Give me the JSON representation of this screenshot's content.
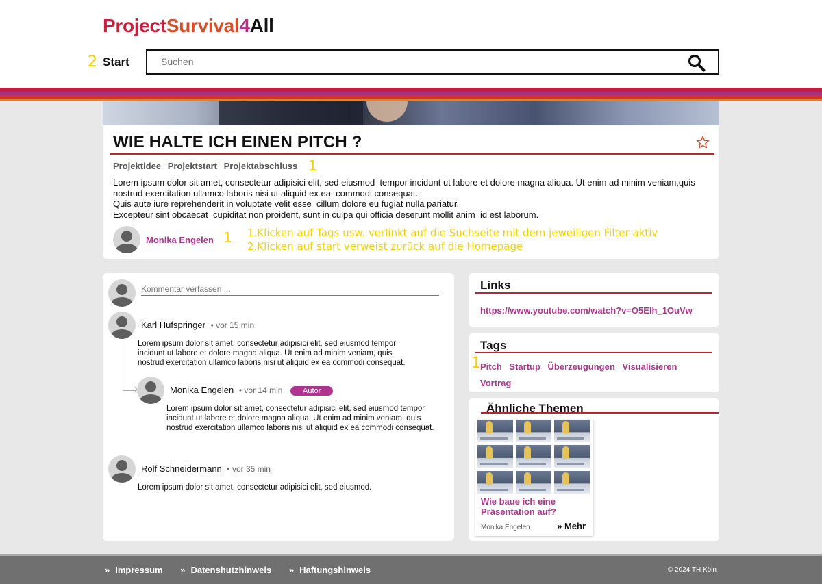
{
  "header": {
    "logo_part1": "Project",
    "logo_part2": "Survival",
    "logo_part3": "4",
    "logo_part4": "All",
    "nav_number": "2",
    "start_label": "Start",
    "search_placeholder": "Suchen"
  },
  "article": {
    "title": "WIE HALTE ICH EINEN PITCH ?",
    "phase_tags": [
      "Projektidee",
      "Projektstart",
      "Projektabschluss"
    ],
    "phase_tags_number": "1",
    "paragraphs": [
      "Lorem ipsum dolor sit amet, consectetur adipisici elit, sed eiusmod  tempor incidunt ut labore et dolore magna aliqua. Ut enim ad minim veniam,quis nostrud exercitation ullamco laboris nisi ut aliquid ex ea  commodi consequat.",
      "Quis aute iure reprehenderit in voluptate velit esse  cillum dolore eu fugiat nulla pariatur.",
      "Excepteur sint obcaecat  cupiditat non proident, sunt in culpa qui officia deserunt mollit anim  id est laborum."
    ],
    "author": "Monika Engelen",
    "author_number": "1"
  },
  "annotations": {
    "line1": "1.Klicken auf Tags usw. verlinkt auf die Suchseite mit dem jeweiligen Filter aktiv",
    "line2": "2.Klicken auf start verweist zurück auf die Homepage"
  },
  "comments": {
    "input_placeholder": "Kommentar verfassen ...",
    "items": [
      {
        "name": "Karl Hufspringer",
        "time": "• vor 15 min",
        "text": "Lorem ipsum dolor sit amet, consectetur adipisici elit, sed eiusmod  tempor incidunt ut labore et dolore magna aliqua. Ut enim ad minim  veniam, quis nostrud exercitation ullamco laboris nisi ut aliquid ex ea  commodi consequat."
      },
      {
        "name": "Monika Engelen",
        "time": "• vor 14 min",
        "badge": "Autor",
        "text": "Lorem ipsum dolor sit amet, consectetur adipisici elit, sed eiusmod tempor incidunt ut labore et dolore magna aliqua. Ut enim ad minim  veniam, quis nostrud exercitation ullamco laboris nisi ut aliquid ex ea  commodi consequat."
      },
      {
        "name": "Rolf Schneidermann",
        "time": "• vor 35 min",
        "text": "Lorem ipsum dolor sit amet, consectetur adipisici elit, sed eiusmod."
      }
    ]
  },
  "links": {
    "title": "Links",
    "url": "https://www.youtube.com/watch?v=O5Elh_1OuVw"
  },
  "tags": {
    "title": "Tags",
    "number": "1",
    "items": [
      "Pitch",
      "Startup",
      "Überzeugungen",
      "Visualisieren",
      "Vortrag"
    ]
  },
  "themes": {
    "title": "Ähnliche Themen",
    "tile": {
      "title": "Wie baue ich eine Präsentation auf?",
      "author": "Monika Engelen",
      "more_label": "Mehr"
    }
  },
  "footer": {
    "links": [
      "Impressum",
      "Datenshutzhinweis",
      "Haftungshinweis"
    ],
    "copyright": "© 2024 TH Köln"
  },
  "colors": {
    "accent_magenta": "#b0338e",
    "accent_red": "#c5213d",
    "rule_red": "#b6282f",
    "annotation_yellow": "#f5d000",
    "footer_gray": "#707070"
  },
  "icons": {
    "search": "search-icon",
    "favorite": "star-icon",
    "chevron": "double-chevron-right-icon"
  }
}
